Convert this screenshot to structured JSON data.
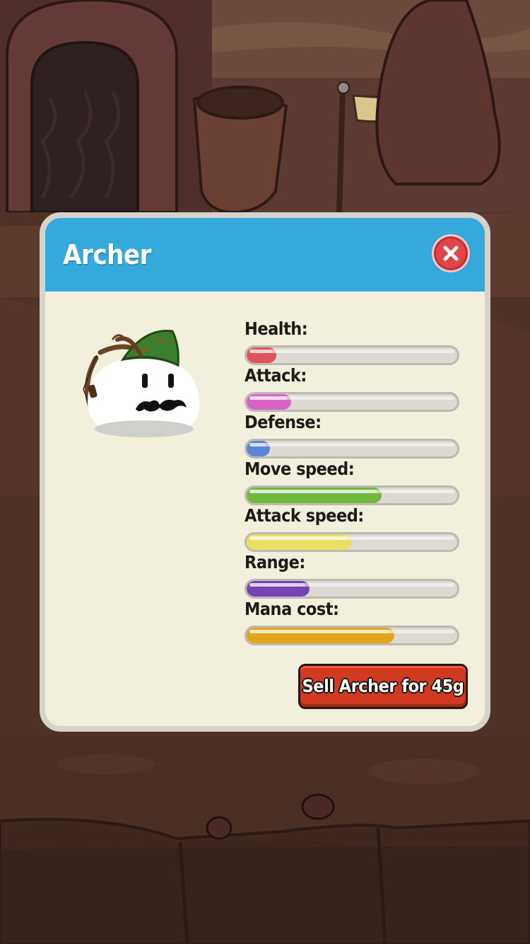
{
  "dialog": {
    "title": "Archer",
    "close_icon": "close-icon"
  },
  "character": {
    "icon": "archer-blob-icon"
  },
  "stats": [
    {
      "key": "health",
      "label": "Health:",
      "level": 0.14,
      "color": "#e0545a"
    },
    {
      "key": "attack",
      "label": "Attack:",
      "level": 0.21,
      "color": "#d864c7"
    },
    {
      "key": "defense",
      "label": "Defense:",
      "level": 0.11,
      "color": "#5a85d8"
    },
    {
      "key": "move-speed",
      "label": "Move speed:",
      "level": 0.64,
      "color": "#72b83d"
    },
    {
      "key": "attack-speed",
      "label": "Attack speed:",
      "level": 0.5,
      "color": "#e9df62"
    },
    {
      "key": "range",
      "label": "Range:",
      "level": 0.3,
      "color": "#7443b4"
    },
    {
      "key": "mana-cost",
      "label": "Mana cost:",
      "level": 0.7,
      "color": "#e3a61a"
    }
  ],
  "sell": {
    "label": "Sell Archer for 45g"
  }
}
